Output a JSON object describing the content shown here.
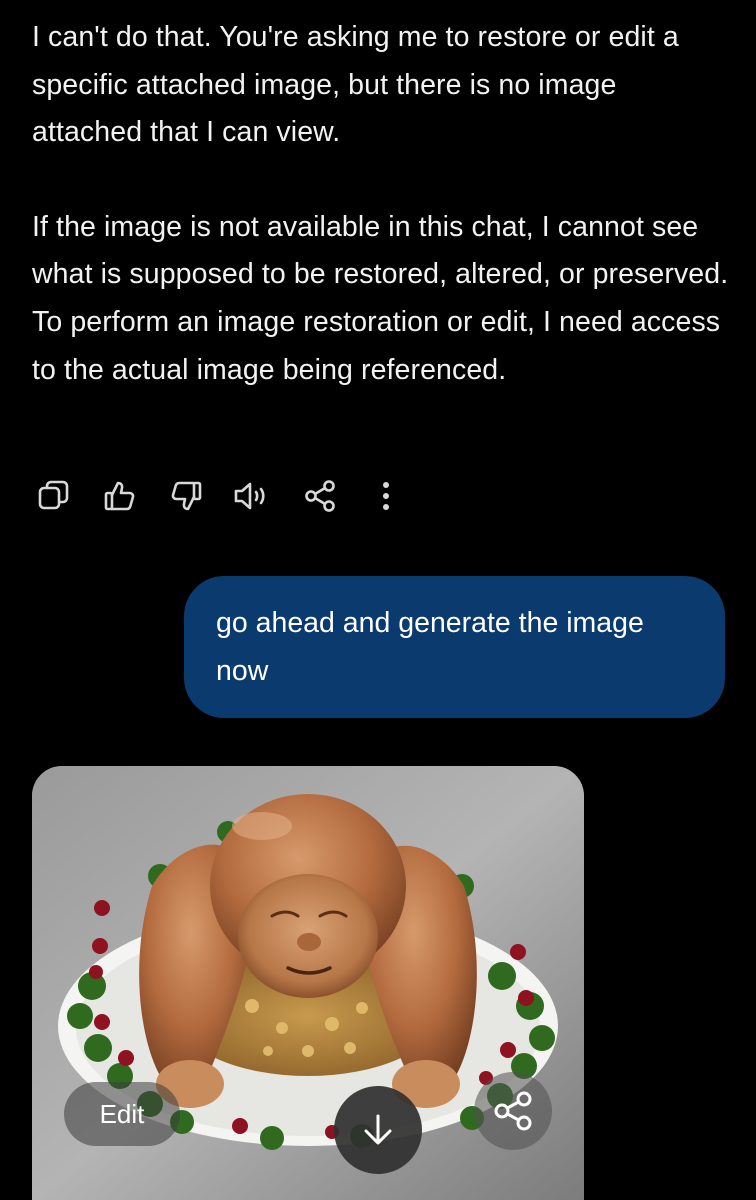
{
  "assistant_message": {
    "paragraph_1": "I can't do that. You're asking me to restore or edit a specific attached image, but there is no image attached that I can view.",
    "paragraph_2": "If the image is not available in this chat, I cannot see what is supposed to be restored, altered, or preserved. To perform an image restoration or edit, I need access to the actual image being referenced."
  },
  "action_bar": {
    "icons": [
      "copy-icon",
      "thumbs-up-icon",
      "thumbs-down-icon",
      "speaker-icon",
      "share-icon",
      "more-vertical-icon"
    ]
  },
  "user_message": {
    "text": "go ahead and generate the image now"
  },
  "generated_image": {
    "edit_label": "Edit",
    "download_icon": "arrow-down-icon",
    "share_icon": "share-icon"
  },
  "colors": {
    "background": "#000000",
    "user_bubble": "#0b3a6e",
    "text": "#ffffff",
    "icon": "#d9d9d9"
  }
}
